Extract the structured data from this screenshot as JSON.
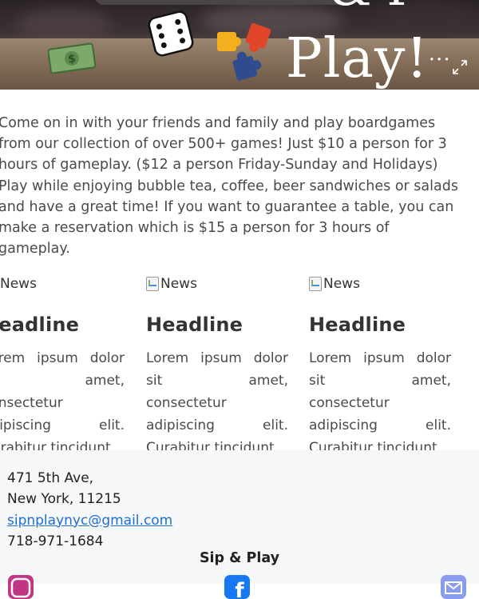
{
  "hero": {
    "title": "Play!",
    "title_suffix": "...",
    "title_top": "& P",
    "expand_icon": "expand-icon"
  },
  "intro": {
    "text": "Come on in with your friends and family and play boardgames from our collection of over 500+ games! Just $10 a person for 3 hours of gameplay. ($12 a person Friday-Sunday and Holidays) Play while enjoying bubble tea, coffee, beer sandwiches or salads and have a great time! If you want to guarantee a table, you can make a reservation which is $15 a person for 3 hours of gameplay."
  },
  "news": [
    {
      "alt": "News",
      "headline": "Headline",
      "body": "Lorem ipsum dolor sit amet, consectetur adipiscing elit. Curabitur tincidunt..."
    },
    {
      "alt": "News",
      "headline": "Headline",
      "body": "Lorem ipsum dolor sit amet, consectetur adipiscing elit. Curabitur tincidunt..."
    },
    {
      "alt": "News",
      "headline": "Headline",
      "body": "Lorem ipsum dolor sit amet, consectetur adipiscing elit. Curabitur tincidunt..."
    }
  ],
  "footer": {
    "street": "471 5th Ave,",
    "city": "New York, 11215",
    "email": "sipnplaynyc@gmail.com",
    "phone": "718-971-1684",
    "brand": "Sip & Play",
    "social": [
      {
        "icon": "instagram-icon",
        "color": "#c13584"
      },
      {
        "icon": "facebook-icon",
        "color": "#1877f2"
      },
      {
        "icon": "email-icon",
        "color": "#8a9cf0"
      }
    ]
  }
}
